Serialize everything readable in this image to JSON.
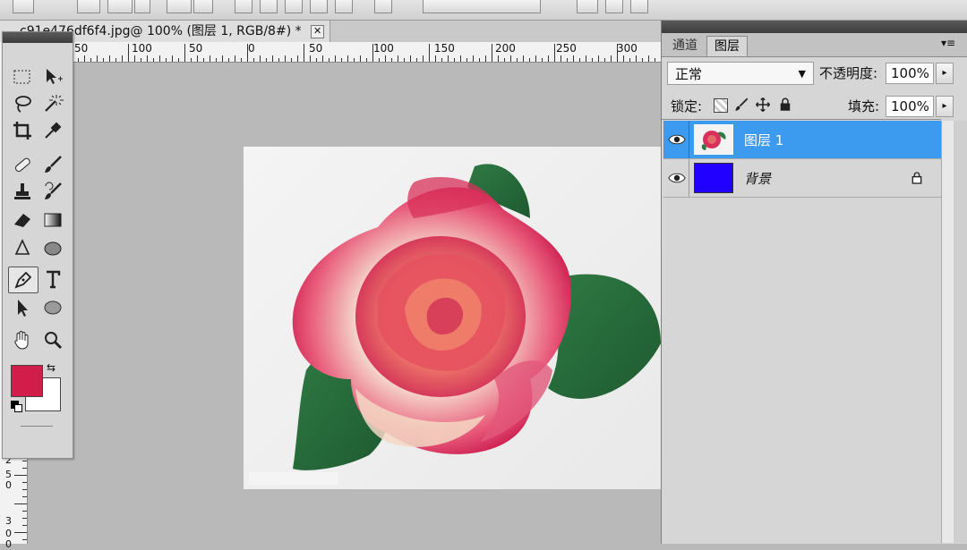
{
  "document": {
    "tab_title": "c91e476df6f4.jpg@ 100% (图层 1, RGB/8#) *",
    "tab_close_label": "✕"
  },
  "rulers": {
    "horizontal_labels": [
      "50",
      "100",
      "50",
      "0",
      "50",
      "100",
      "150",
      "200",
      "250",
      "300"
    ],
    "vertical_labels": [
      "2",
      "5",
      "0",
      "3",
      "0",
      "0"
    ]
  },
  "toolbox": {
    "tools": [
      "rectangular-marquee",
      "move",
      "lasso",
      "magic-wand",
      "crop",
      "eyedropper",
      "healing-brush",
      "brush",
      "clone-stamp",
      "history-brush",
      "eraser",
      "gradient",
      "blur",
      "dodge",
      "pen",
      "type",
      "path-selection",
      "ellipse",
      "hand",
      "zoom"
    ],
    "foreground_color": "#d21c4a",
    "background_color": "#ffffff"
  },
  "layers_panel": {
    "tabs": [
      "通道",
      "图层"
    ],
    "active_tab": "图层",
    "blend_mode": "正常",
    "opacity_label": "不透明度:",
    "opacity_value": "100%",
    "lock_label": "锁定:",
    "fill_label": "填充:",
    "fill_value": "100%",
    "layers": [
      {
        "name": "图层 1",
        "selected": true,
        "visible": true
      },
      {
        "name": "背景",
        "selected": false,
        "visible": true,
        "locked": true,
        "fill": "#2200ff"
      }
    ]
  },
  "colors": {
    "selection_blue": "#3d9bef",
    "workspace_gray": "#b9b9b9"
  }
}
